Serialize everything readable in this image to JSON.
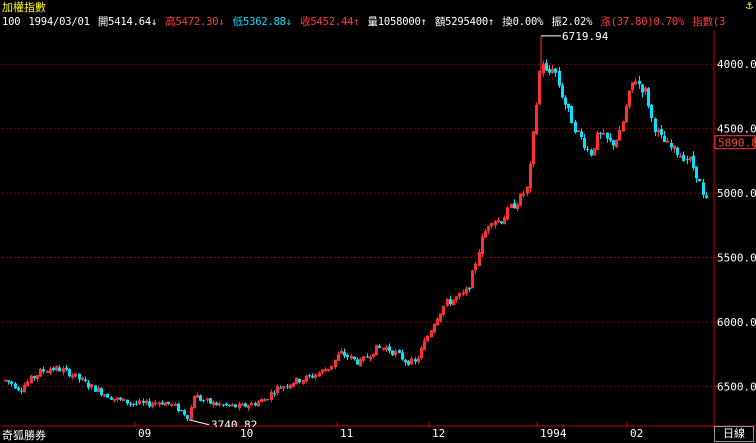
{
  "header": {
    "title": "加權指數",
    "anchor_icon": "anchor-icon"
  },
  "info_line": {
    "period": "100",
    "date": "1994/03/01",
    "open": "開5414.64↓",
    "high": "高5472.30↓",
    "low": "低5362.88↓",
    "close": "收5452.44↑",
    "volume": "量1058000↑",
    "amount": "額5295400↑",
    "turnover": "換0.00%",
    "amplitude": "振2.02%",
    "change": "漲(37.80)0.70%",
    "index_label": "指數(3"
  },
  "chart": {
    "y_ticks": [
      "6500.0",
      "6000.0",
      "5500.0",
      "5000.0",
      "4500.0",
      "4000.0"
    ],
    "price_marker": "5890.8",
    "high_annotation": "6719.94",
    "low_annotation": "3740.82",
    "x_labels": [
      "09",
      "10",
      "11",
      "12",
      "1994",
      "02"
    ],
    "colors": {
      "up": "#ff3030",
      "down": "#00e5ff",
      "grid": "#b00000",
      "axis": "#c00000",
      "marker": "#ff4040"
    }
  },
  "chart_data": {
    "type": "candlestick",
    "title": "加權指數",
    "ylim": [
      3700,
      6750
    ],
    "yticks": [
      4000,
      4500,
      5000,
      5500,
      6000,
      6500
    ],
    "xlabels": [
      "09",
      "10",
      "11",
      "12",
      "1994",
      "02"
    ],
    "annotations": {
      "high": 6719.94,
      "low": 3740.82,
      "current": 5890.8
    }
  },
  "footer": {
    "brand": "奇狐勝券",
    "period_button": "日線"
  }
}
